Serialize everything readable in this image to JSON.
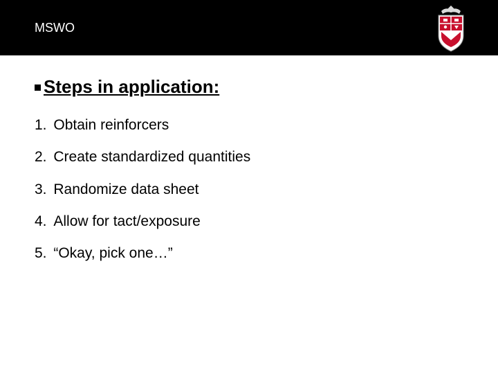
{
  "header": {
    "title": "MSWO"
  },
  "subheading": "Steps in application:",
  "steps": [
    {
      "num": "1.",
      "text": "Obtain reinforcers"
    },
    {
      "num": "2.",
      "text": "Create standardized quantities"
    },
    {
      "num": "3.",
      "text": "Randomize data sheet"
    },
    {
      "num": "4.",
      "text": "Allow for tact/exposure"
    },
    {
      "num": "5.",
      "text": "“Okay, pick one…”"
    }
  ],
  "colors": {
    "crest_red": "#C8102E",
    "crest_grey": "#D9D9D9"
  }
}
